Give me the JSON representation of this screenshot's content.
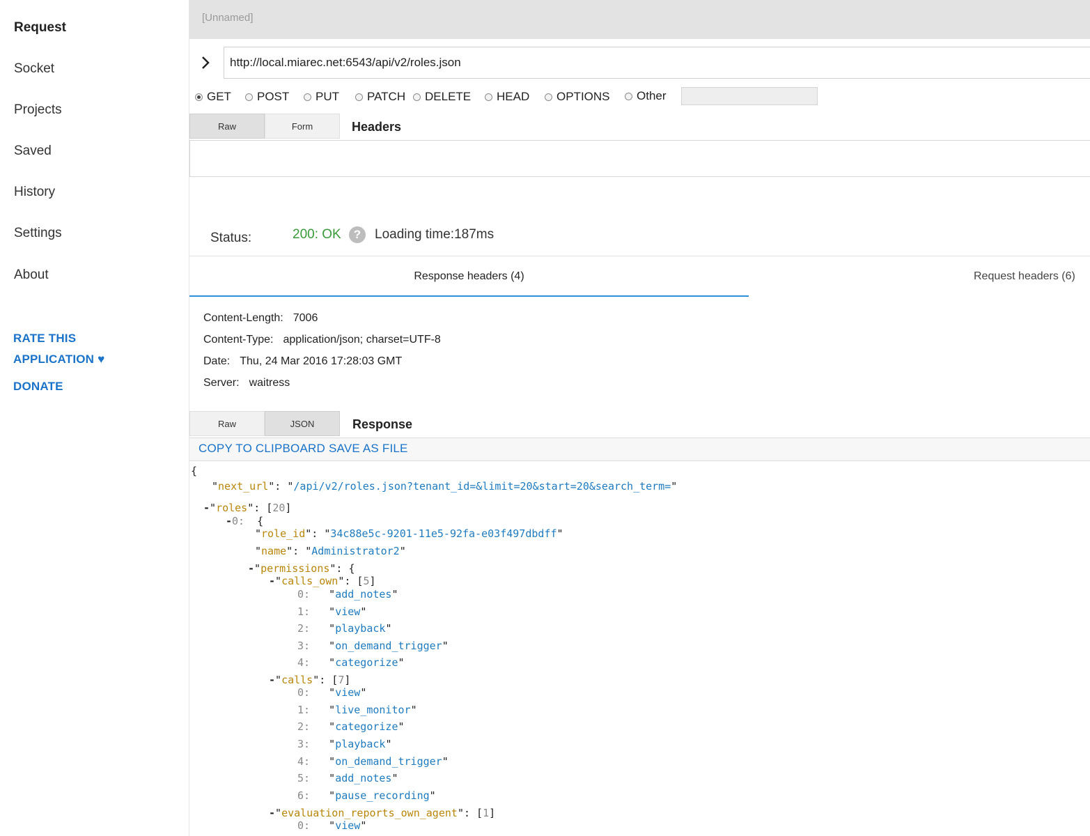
{
  "sidebar": {
    "nav": [
      "Request",
      "Socket",
      "Projects",
      "Saved",
      "History",
      "Settings",
      "About"
    ],
    "rate_line1": "RATE THIS",
    "rate_line2": "APPLICATION ♥",
    "donate": "DONATE"
  },
  "request": {
    "name": "[Unnamed]",
    "url": "http://local.miarec.net:6543/api/v2/roles.json",
    "methods": [
      "GET",
      "POST",
      "PUT",
      "PATCH",
      "DELETE",
      "HEAD",
      "OPTIONS",
      "Other"
    ],
    "selected_method": "GET",
    "headers_tabs": [
      "Raw",
      "Form"
    ],
    "headers_title": "Headers"
  },
  "status": {
    "label": "Status:",
    "value": "200: OK",
    "help": "?",
    "loading": "Loading time:187ms"
  },
  "tabs": {
    "response_headers": "Response headers (4)",
    "request_headers": "Request headers (6)"
  },
  "response_headers": [
    {
      "name": "Content-Length:",
      "value": "7006"
    },
    {
      "name": "Content-Type:",
      "value": "application/json; charset=UTF-8"
    },
    {
      "name": "Date:",
      "value": "Thu, 24 Mar 2016 17:28:03 GMT"
    },
    {
      "name": "Server:",
      "value": "waitress"
    }
  ],
  "response": {
    "tabs": [
      "Raw",
      "JSON"
    ],
    "title": "Response",
    "copy": "COPY TO CLIPBOARD",
    "save": "SAVE AS FILE"
  },
  "json": {
    "open_brace": "{",
    "next_url_key": "next_url",
    "next_url_value": "/api/v2/roles.json?tenant_id=&limit=20&start=20&search_term=",
    "roles_key": "roles",
    "roles_count": "20",
    "item0_index": "0:",
    "role_id_key": "role_id",
    "role_id_value": "34c88e5c-9201-11e5-92fa-e03f497dbdff",
    "name_key": "name",
    "name_value": "Administrator2",
    "permissions_key": "permissions",
    "calls_own_key": "calls_own",
    "calls_own_count": "5",
    "calls_own": [
      "add_notes",
      "view",
      "playback",
      "on_demand_trigger",
      "categorize"
    ],
    "calls_key": "calls",
    "calls_count": "7",
    "calls": [
      "view",
      "live_monitor",
      "categorize",
      "playback",
      "on_demand_trigger",
      "add_notes",
      "pause_recording"
    ],
    "eval_key": "evaluation_reports_own_agent",
    "eval_count": "1",
    "eval": [
      "view"
    ]
  }
}
